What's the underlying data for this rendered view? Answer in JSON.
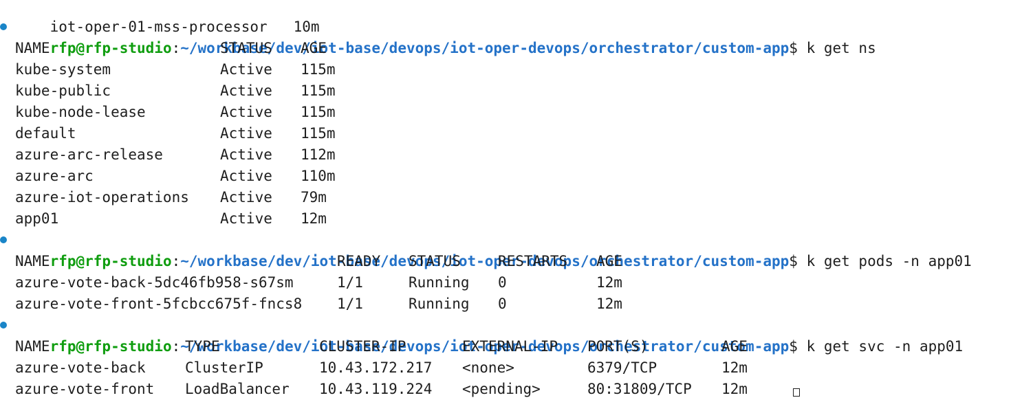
{
  "terminal": {
    "cut_line": "iot-oper-01-mss-processor   10m",
    "prompt": {
      "user_host": "rfp@rfp-studio",
      "colon": ":",
      "path": "~/workbase/dev/iot-base/devops/iot-oper-devops/orchestrator/custom-app",
      "dollar": "$"
    },
    "blocks": [
      {
        "command": "k get ns",
        "headers": [
          "NAME",
          "STATUS",
          "AGE"
        ],
        "rows": [
          [
            "kube-system",
            "Active",
            "115m"
          ],
          [
            "kube-public",
            "Active",
            "115m"
          ],
          [
            "kube-node-lease",
            "Active",
            "115m"
          ],
          [
            "default",
            "Active",
            "115m"
          ],
          [
            "azure-arc-release",
            "Active",
            "112m"
          ],
          [
            "azure-arc",
            "Active",
            "110m"
          ],
          [
            "azure-iot-operations",
            "Active",
            "79m"
          ],
          [
            "app01",
            "Active",
            "12m"
          ]
        ]
      },
      {
        "command": "k get pods -n app01",
        "headers": [
          "NAME",
          "READY",
          "STATUS",
          "RESTARTS",
          "AGE"
        ],
        "rows": [
          [
            "azure-vote-back-5dc46fb958-s67sm",
            "1/1",
            "Running",
            "0",
            "12m"
          ],
          [
            "azure-vote-front-5fcbcc675f-fncs8",
            "1/1",
            "Running",
            "0",
            "12m"
          ]
        ]
      },
      {
        "command": "k get svc -n app01",
        "headers": [
          "NAME",
          "TYPE",
          "CLUSTER-IP",
          "EXTERNAL-IP",
          "PORT(S)",
          "AGE"
        ],
        "rows": [
          [
            "azure-vote-back",
            "ClusterIP",
            "10.43.172.217",
            "<none>",
            "6379/TCP",
            "12m"
          ],
          [
            "azure-vote-front",
            "LoadBalancer",
            "10.43.119.224",
            "<pending>",
            "80:31809/TCP",
            "12m"
          ]
        ]
      }
    ],
    "colors": {
      "user_host": "#0f9d0f",
      "path": "#2472c8",
      "indicator_dot": "#1a85c8",
      "text": "#1e1e1e"
    }
  }
}
